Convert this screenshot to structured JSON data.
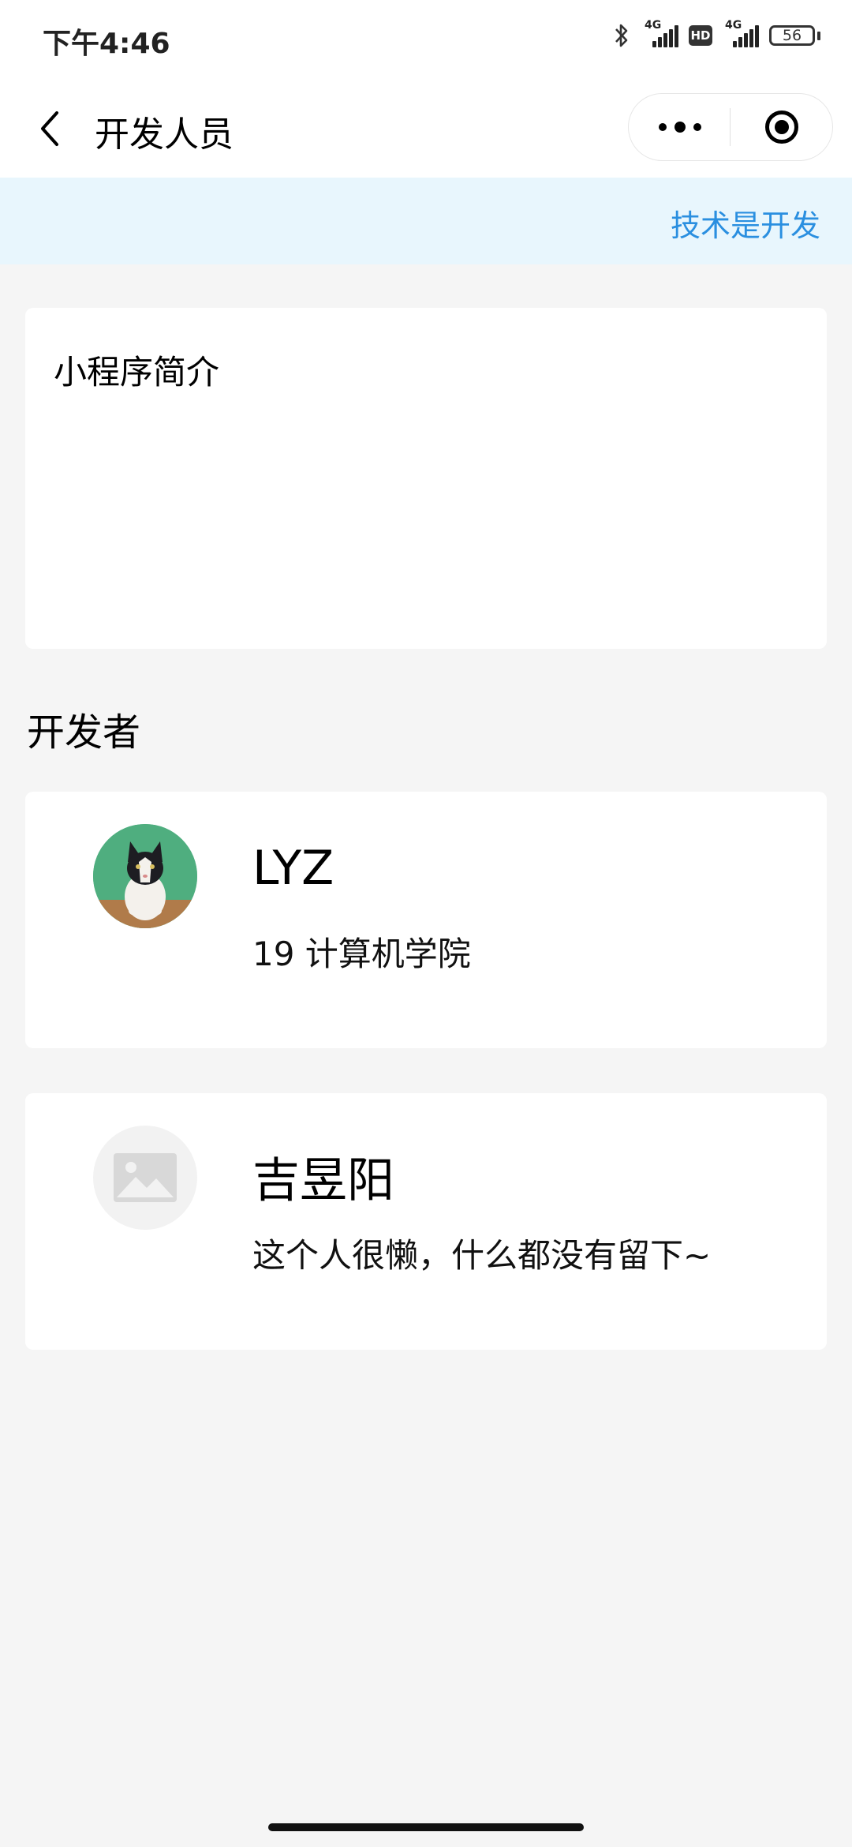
{
  "status_bar": {
    "time": "下午4:46",
    "sim1_tag": "4G",
    "sim2_tag": "4G",
    "hd_label": "HD",
    "battery": "56"
  },
  "nav": {
    "title": "开发人员"
  },
  "notice": {
    "text": "技术是开发"
  },
  "intro": {
    "title": "小程序简介"
  },
  "developers_section": {
    "title": "开发者",
    "developers": [
      {
        "name": "LYZ",
        "description": "19 计算机学院",
        "avatar": "cat-photo-avatar"
      },
      {
        "name": "吉昱阳",
        "description": "这个人很懒，什么都没有留下~",
        "avatar": "image-placeholder-icon"
      }
    ]
  },
  "colors": {
    "accent": "#2a8fe0",
    "notice_bg": "#e8f6fd",
    "page_bg": "#f5f5f5"
  }
}
